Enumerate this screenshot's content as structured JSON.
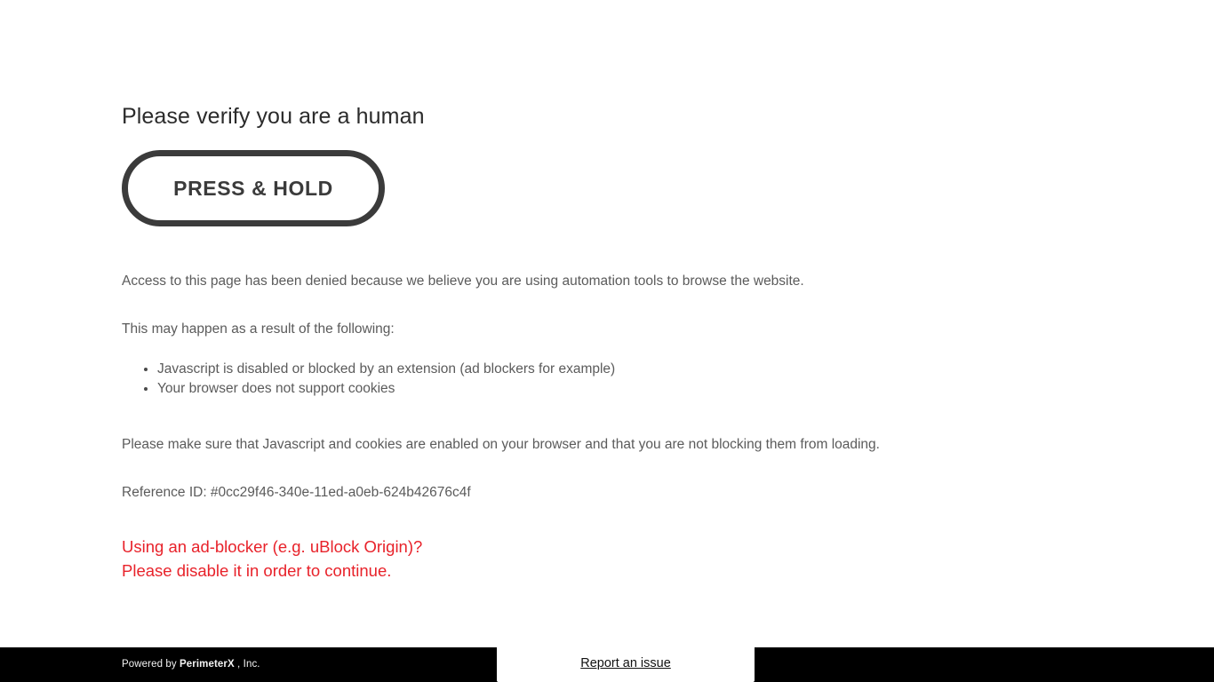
{
  "page": {
    "heading": "Please verify you are a human",
    "background_color": "#ffffff"
  },
  "verify_button": {
    "label": "PRESS & HOLD",
    "border_color": "#3b3b3b",
    "text_color": "#3b3b3b"
  },
  "messages": {
    "denied": "Access to this page has been denied because we believe you are using automation tools to browse the website.",
    "may_happen": "This may happen as a result of the following:",
    "reasons": [
      "Javascript is disabled or blocked by an extension (ad blockers for example)",
      "Your browser does not support cookies"
    ],
    "enable_instructions": "Please make sure that Javascript and cookies are enabled on your browser and that you are not blocking them from loading.",
    "reference_id": "Reference ID: #0cc29f46-340e-11ed-a0eb-624b42676c4f",
    "text_color": "#5b5b5b"
  },
  "adblock_warning": {
    "line1": "Using an ad-blocker (e.g. uBlock Origin)?",
    "line2": "Please disable it in order to continue.",
    "color": "#e8222a"
  },
  "footer": {
    "powered_by_prefix": "Powered by ",
    "brand": "PerimeterX",
    "powered_by_suffix": " , Inc.",
    "report_issue_label": "Report an issue",
    "background_color": "#000000",
    "text_color": "#f2f2f2"
  }
}
